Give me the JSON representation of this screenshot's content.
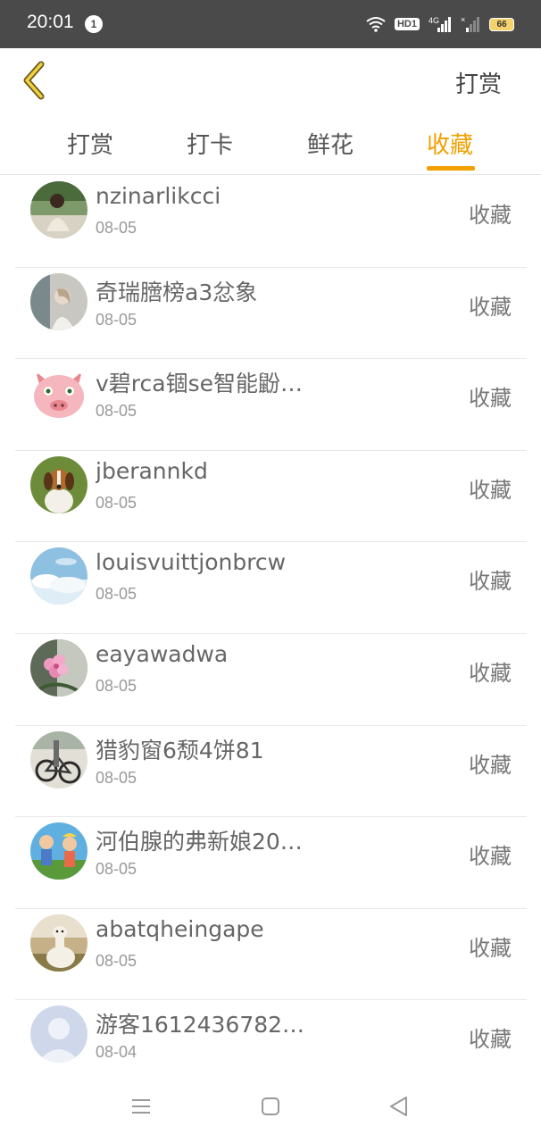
{
  "status_bar": {
    "time": "20:01",
    "notification_count": "1",
    "hd_label": "HD1",
    "network_label": "4G",
    "battery": "66"
  },
  "header": {
    "right_label": "打赏"
  },
  "tabs": [
    {
      "label": "打赏",
      "active": false
    },
    {
      "label": "打卡",
      "active": false
    },
    {
      "label": "鲜花",
      "active": false
    },
    {
      "label": "收藏",
      "active": true
    }
  ],
  "accent_color": "#f0a000",
  "list": [
    {
      "name": "nzinarlikcci",
      "date": "08-05",
      "action": "收藏",
      "avatar": "avatar-woman-green"
    },
    {
      "name": "奇瑞膪榜a3忿象",
      "date": "08-05",
      "action": "收藏",
      "avatar": "avatar-woman-white"
    },
    {
      "name": "v碧rca锢se智能鼢…",
      "date": "08-05",
      "action": "收藏",
      "avatar": "avatar-pig"
    },
    {
      "name": "jberannkd",
      "date": "08-05",
      "action": "收藏",
      "avatar": "avatar-dog"
    },
    {
      "name": "louisvuittjonbrcw",
      "date": "08-05",
      "action": "收藏",
      "avatar": "avatar-sky"
    },
    {
      "name": "eayawadwa",
      "date": "08-05",
      "action": "收藏",
      "avatar": "avatar-flower"
    },
    {
      "name": "猎豹窗6颓4饼81",
      "date": "08-05",
      "action": "收藏",
      "avatar": "avatar-bicycle"
    },
    {
      "name": "河伯腺的弗新娘20…",
      "date": "08-05",
      "action": "收藏",
      "avatar": "avatar-cartoon"
    },
    {
      "name": "abatqheingape",
      "date": "08-05",
      "action": "收藏",
      "avatar": "avatar-alpaca"
    },
    {
      "name": "游客1612436782…",
      "date": "08-04",
      "action": "收藏",
      "avatar": "avatar-default"
    }
  ]
}
